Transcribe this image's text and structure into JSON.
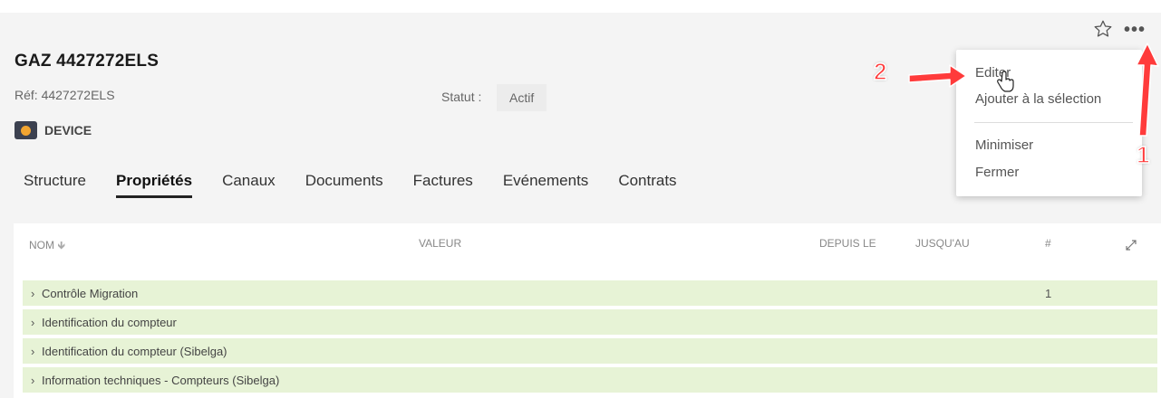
{
  "header": {
    "title": "GAZ 4427272ELS",
    "ref": "Réf: 4427272ELS",
    "statut_label": "Statut :",
    "statut_value": "Actif",
    "device_label": "DEVICE"
  },
  "tabs": [
    {
      "label": "Structure"
    },
    {
      "label": "Propriétés",
      "active": true
    },
    {
      "label": "Canaux"
    },
    {
      "label": "Documents"
    },
    {
      "label": "Factures"
    },
    {
      "label": "Evénements"
    },
    {
      "label": "Contrats"
    }
  ],
  "menu": {
    "items": [
      "Editer",
      "Ajouter à la sélection",
      "Minimiser",
      "Fermer"
    ]
  },
  "table": {
    "columns": [
      "NOM",
      "VALEUR",
      "DEPUIS LE",
      "JUSQU'AU",
      "#"
    ],
    "rows": [
      {
        "label": "Contrôle Migration",
        "count": "1"
      },
      {
        "label": "Identification du compteur",
        "count": ""
      },
      {
        "label": "Identification du compteur (Sibelga)",
        "count": ""
      },
      {
        "label": "Information techniques - Compteurs (Sibelga)",
        "count": ""
      }
    ]
  },
  "annotations": {
    "step1": "1",
    "step2": "2"
  },
  "colors": {
    "accent": "#ff3b3b",
    "row_bg": "#e7f3d6",
    "device_icon": "#f2a531"
  },
  "icons": {
    "star": "star-icon",
    "more": "more-icon",
    "expand": "expand-icon",
    "sort": "arrow-down-icon",
    "chevron": "chevron-right-icon"
  }
}
